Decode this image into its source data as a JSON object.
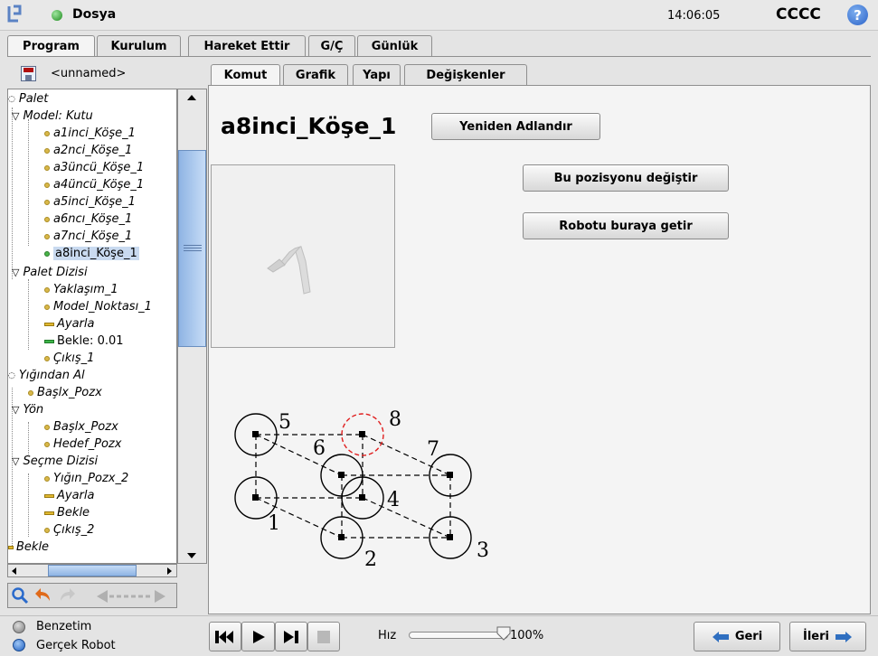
{
  "header": {
    "menu_title": "Dosya",
    "time": "14:06:05",
    "robot_name": "CCCC",
    "help_icon": "question-circle-icon"
  },
  "main_tabs": [
    "Program",
    "Kurulum",
    "Hareket Ettir",
    "G/Ç",
    "Günlük"
  ],
  "program_name": "<unnamed>",
  "sub_tabs": [
    "Komut",
    "Grafik",
    "Yapı",
    "Değişkenler"
  ],
  "tree": [
    "Palet",
    "Model: Kutu",
    "a1inci_Köşe_1",
    "a2nci_Köşe_1",
    "a3üncü_Köşe_1",
    "a4üncü_Köşe_1",
    "a5inci_Köşe_1",
    "a6ncı_Köşe_1",
    "a7nci_Köşe_1",
    "a8inci_Köşe_1",
    "Palet Dizisi",
    "Yaklaşım_1",
    "Model_Noktası_1",
    "Ayarla",
    "Bekle: 0.01",
    "Çıkış_1",
    "Yığından Al",
    "Başlx_Pozx",
    "Yön",
    "Başlx_Pozx",
    "Hedef_Pozx",
    "Seçme Dizisi",
    "Yığın_Pozx_2",
    "Ayarla",
    "Bekle",
    "Çıkış_2",
    "Bekle"
  ],
  "command": {
    "title": "a8inci_Köşe_1",
    "rename_button": "Yeniden Adlandır",
    "change_position_button": "Bu pozisyonu değiştir",
    "move_robot_button": "Robotu buraya getir"
  },
  "diagram_labels": [
    "1",
    "2",
    "3",
    "4",
    "5",
    "6",
    "7",
    "8"
  ],
  "bottom": {
    "simulation": "Benzetim",
    "real_robot": "Gerçek Robot",
    "speed_label": "Hız",
    "speed_value": "100%",
    "speed_fraction": 1.0,
    "back_button": "Geri",
    "next_button": "İleri"
  },
  "colors": {
    "selection": "#c9daf0",
    "highlight_circle": "#e02020",
    "accent_blue": "#2f6fc0"
  }
}
